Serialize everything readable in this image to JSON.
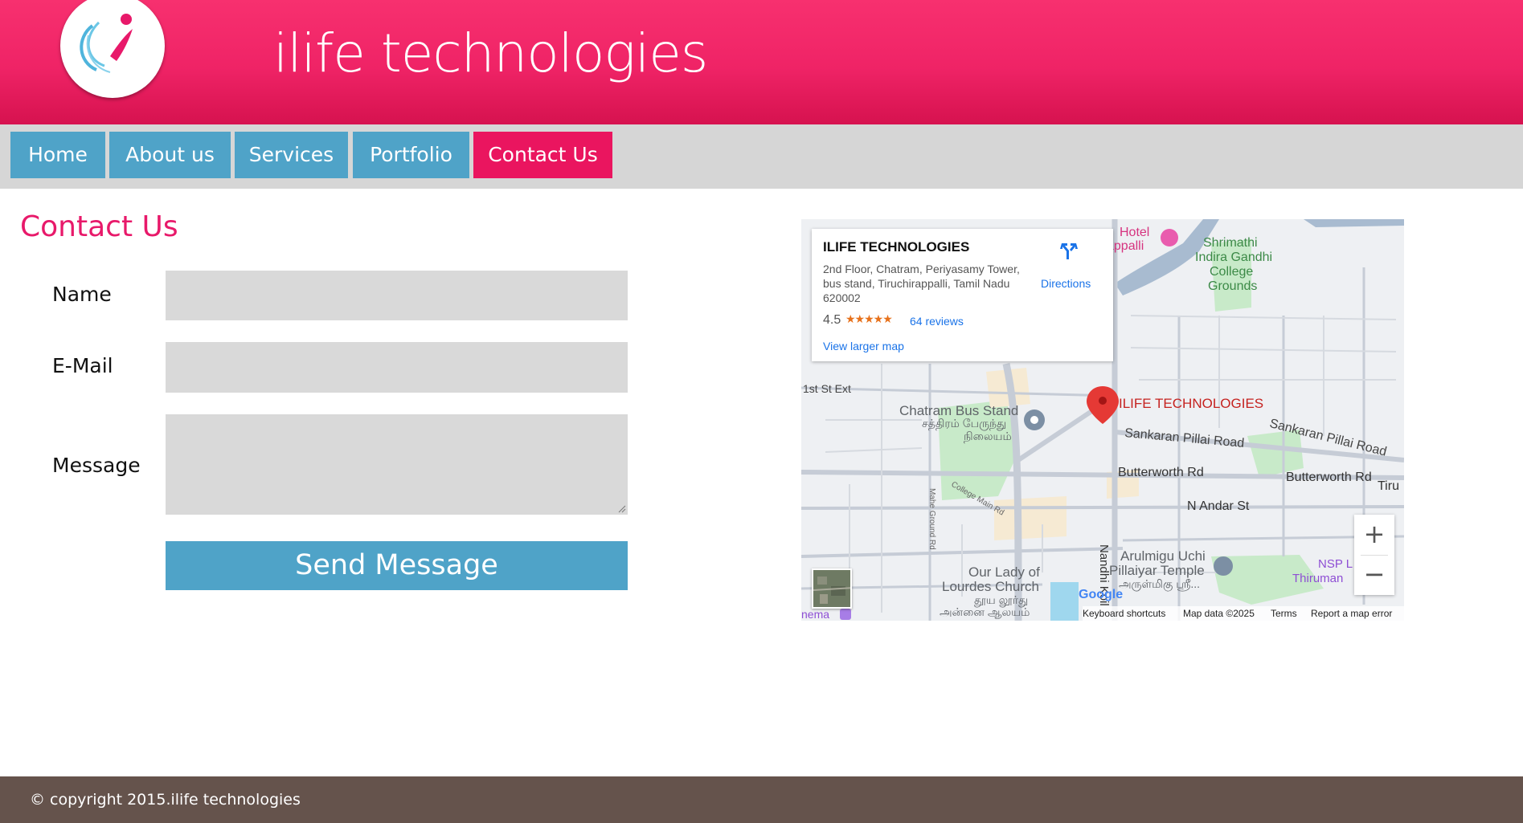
{
  "header": {
    "site_title": "ilife technologies",
    "logo_icon": "ilife-logo-icon"
  },
  "nav": {
    "items": [
      {
        "label": "Home",
        "active": false
      },
      {
        "label": "About us",
        "active": false
      },
      {
        "label": "Services",
        "active": false
      },
      {
        "label": "Portfolio",
        "active": false
      },
      {
        "label": "Contact Us",
        "active": true
      }
    ]
  },
  "contact": {
    "title": "Contact Us",
    "fields": [
      {
        "label": "Name",
        "value": ""
      },
      {
        "label": "E-Mail",
        "value": ""
      },
      {
        "label": "Message",
        "value": ""
      }
    ],
    "send_label": "Send Message"
  },
  "map": {
    "card": {
      "name": "ILIFE TECHNOLOGIES",
      "address": "2nd Floor, Chatram, Periyasamy Tower, bus stand, Tiruchirappalli, Tamil Nadu 620002",
      "rating": "4.5",
      "stars": "★★★★★",
      "reviews": "64 reviews",
      "directions": "Directions",
      "view_larger": "View larger map"
    },
    "labels": {
      "pin": "ILIFE TECHNOLOGIES",
      "bus_stand": "Chatram Bus Stand",
      "bus_stand_tamil": "சத்திரம் பேருந்து",
      "bus_stand_tamil2": "நிலையம்",
      "first_st": "1st St Ext",
      "sankaran1": "Sankaran Pillai Road",
      "sankaran2": "Sankaran Pillai Road",
      "butterworth1": "Butterworth Rd",
      "butterworth2": "Butterworth Rd",
      "andar": "N Andar St",
      "nandhi": "Nandhi Koil",
      "college_main": "College Main Rd",
      "mahe": "Mahe Ground Rd",
      "temple1": "Arulmigu Uchi",
      "temple2": "Pillaiyar Temple",
      "temple_tamil": "அருள்மிகு ஸ்ரீ...",
      "church1": "Our Lady of",
      "church2": "Lourdes Church",
      "church_tamil1": "தூய லூர்து",
      "church_tamil2": "அன்னை ஆலயம்",
      "college1": "Shrimathi",
      "college2": "Indira Gandhi",
      "college3": "College",
      "college4": "Grounds",
      "hotel": "Hotel",
      "hotel2": "appalli",
      "nsp": "NSP L",
      "thiruman": "Thiruman",
      "tiru": "Tiru",
      "nema": "nema",
      "google": "Google"
    },
    "zoom_in": "+",
    "zoom_out": "−",
    "attribution": {
      "shortcuts": "Keyboard shortcuts",
      "data": "Map data ©2025",
      "terms": "Terms",
      "report": "Report a map error"
    }
  },
  "footer": {
    "copyright": "© copyright 2015.ilife technologies"
  },
  "colors": {
    "header_pink": "#ef2366",
    "nav_blue": "#4fa3c8",
    "nav_active": "#ea155f",
    "title_pink": "#e8196a",
    "footer_brown": "#65534c"
  }
}
